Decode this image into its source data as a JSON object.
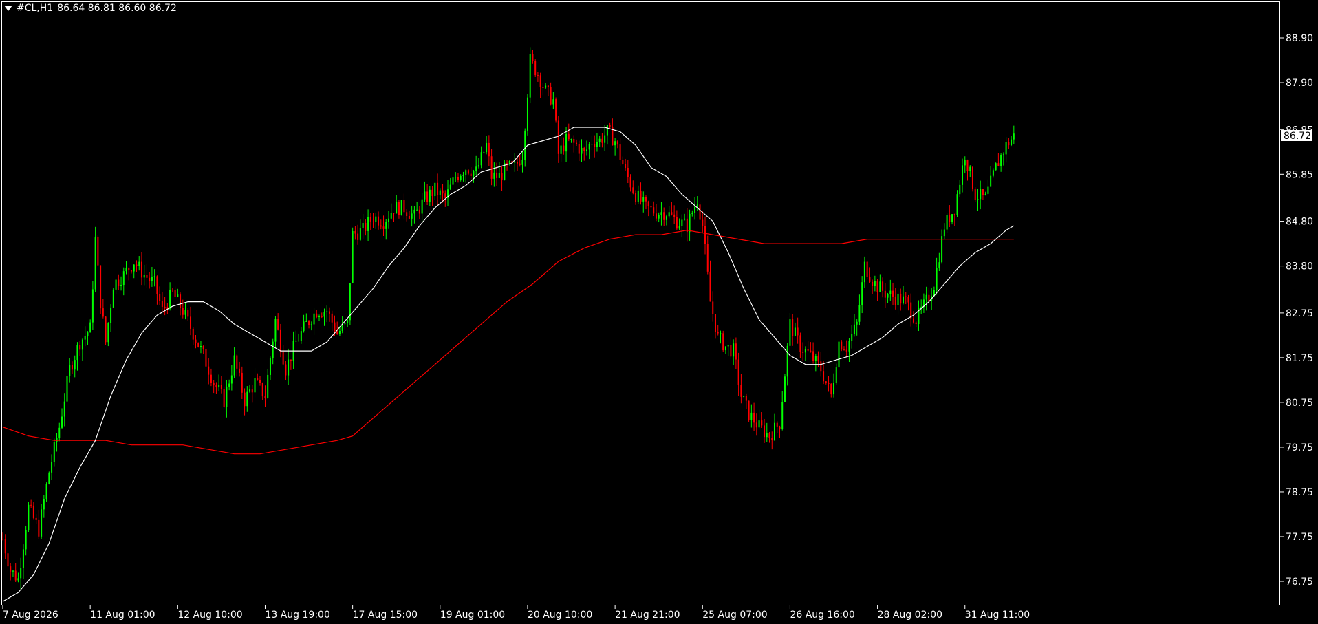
{
  "header": {
    "symbol_tf": "#CL,H1",
    "ohlc": "86.64 86.81 86.60 86.72"
  },
  "colors": {
    "background": "#000000",
    "bull": "#00ff00",
    "bear": "#ff0000",
    "ma_fast": "#ffffff",
    "ma_slow": "#ff0000",
    "axis": "#ffffff"
  },
  "chart_data": {
    "type": "candlestick",
    "symbol": "#CL",
    "timeframe": "H1",
    "last_price_label": "86.72",
    "ylim": [
      76.2,
      89.5
    ],
    "y_ticks": [
      "88.90",
      "87.90",
      "86.85",
      "85.85",
      "84.80",
      "83.80",
      "82.75",
      "81.75",
      "80.75",
      "79.75",
      "78.75",
      "77.75",
      "76.75"
    ],
    "x_labels": [
      "7 Aug 2026",
      "11 Aug 01:00",
      "12 Aug 10:00",
      "13 Aug 19:00",
      "17 Aug 15:00",
      "19 Aug 01:00",
      "20 Aug 10:00",
      "21 Aug 21:00",
      "25 Aug 07:00",
      "26 Aug 16:00",
      "28 Aug 02:00",
      "31 Aug 11:00"
    ],
    "x_label_index": [
      0,
      34,
      68,
      102,
      136,
      170,
      204,
      238,
      272,
      306,
      340,
      374
    ],
    "close_path": [
      [
        0,
        77.7
      ],
      [
        3,
        77.0
      ],
      [
        6,
        76.8
      ],
      [
        10,
        78.4
      ],
      [
        14,
        77.9
      ],
      [
        18,
        79.2
      ],
      [
        22,
        80.2
      ],
      [
        26,
        81.5
      ],
      [
        30,
        82.1
      ],
      [
        34,
        82.4
      ],
      [
        36,
        84.4
      ],
      [
        38,
        83.0
      ],
      [
        40,
        82.1
      ],
      [
        43,
        83.4
      ],
      [
        47,
        83.6
      ],
      [
        51,
        83.9
      ],
      [
        55,
        83.6
      ],
      [
        59,
        83.4
      ],
      [
        62,
        82.8
      ],
      [
        66,
        83.2
      ],
      [
        70,
        82.8
      ],
      [
        74,
        82.3
      ],
      [
        78,
        81.8
      ],
      [
        82,
        81.2
      ],
      [
        86,
        80.8
      ],
      [
        90,
        81.7
      ],
      [
        94,
        80.8
      ],
      [
        98,
        81.2
      ],
      [
        102,
        80.9
      ],
      [
        106,
        82.6
      ],
      [
        110,
        81.5
      ],
      [
        114,
        82.1
      ],
      [
        118,
        82.5
      ],
      [
        122,
        82.8
      ],
      [
        126,
        82.8
      ],
      [
        130,
        82.3
      ],
      [
        134,
        82.5
      ],
      [
        136,
        84.5
      ],
      [
        140,
        84.6
      ],
      [
        144,
        84.9
      ],
      [
        148,
        84.8
      ],
      [
        152,
        85.1
      ],
      [
        156,
        85.1
      ],
      [
        160,
        84.9
      ],
      [
        164,
        85.3
      ],
      [
        168,
        85.5
      ],
      [
        172,
        85.3
      ],
      [
        176,
        85.8
      ],
      [
        180,
        86.0
      ],
      [
        184,
        85.9
      ],
      [
        188,
        86.5
      ],
      [
        190,
        85.8
      ],
      [
        193,
        85.8
      ],
      [
        196,
        86.0
      ],
      [
        199,
        86.0
      ],
      [
        202,
        86.3
      ],
      [
        205,
        88.4
      ],
      [
        208,
        88.1
      ],
      [
        211,
        87.7
      ],
      [
        214,
        87.5
      ],
      [
        216,
        86.3
      ],
      [
        219,
        86.6
      ],
      [
        223,
        86.5
      ],
      [
        226,
        86.3
      ],
      [
        229,
        86.6
      ],
      [
        232,
        86.6
      ],
      [
        235,
        86.8
      ],
      [
        238,
        86.6
      ],
      [
        242,
        85.9
      ],
      [
        246,
        85.4
      ],
      [
        250,
        85.1
      ],
      [
        254,
        85.0
      ],
      [
        258,
        85.0
      ],
      [
        262,
        84.8
      ],
      [
        266,
        84.7
      ],
      [
        270,
        85.3
      ],
      [
        272,
        84.7
      ],
      [
        275,
        83.0
      ],
      [
        278,
        82.2
      ],
      [
        281,
        82.0
      ],
      [
        284,
        81.9
      ],
      [
        287,
        80.9
      ],
      [
        290,
        80.5
      ],
      [
        294,
        80.2
      ],
      [
        298,
        80.0
      ],
      [
        302,
        80.3
      ],
      [
        306,
        82.5
      ],
      [
        310,
        82.0
      ],
      [
        314,
        81.8
      ],
      [
        318,
        81.5
      ],
      [
        322,
        80.9
      ],
      [
        325,
        82.1
      ],
      [
        328,
        82.0
      ],
      [
        332,
        82.5
      ],
      [
        335,
        83.8
      ],
      [
        339,
        83.4
      ],
      [
        343,
        83.2
      ],
      [
        347,
        83.1
      ],
      [
        351,
        83.0
      ],
      [
        355,
        82.6
      ],
      [
        359,
        83.0
      ],
      [
        362,
        83.4
      ],
      [
        366,
        84.7
      ],
      [
        370,
        85.1
      ],
      [
        374,
        86.3
      ],
      [
        378,
        85.4
      ],
      [
        382,
        85.3
      ],
      [
        386,
        86.0
      ],
      [
        390,
        86.5
      ],
      [
        393,
        86.7
      ]
    ],
    "series": [
      {
        "type": "moving_average",
        "points": [
          [
            0,
            76.3
          ],
          [
            6,
            76.5
          ],
          [
            12,
            76.9
          ],
          [
            18,
            77.6
          ],
          [
            24,
            78.6
          ],
          [
            30,
            79.3
          ],
          [
            36,
            79.9
          ],
          [
            42,
            80.9
          ],
          [
            48,
            81.7
          ],
          [
            54,
            82.3
          ],
          [
            60,
            82.7
          ],
          [
            66,
            82.9
          ],
          [
            72,
            83.0
          ],
          [
            78,
            83.0
          ],
          [
            84,
            82.8
          ],
          [
            90,
            82.5
          ],
          [
            96,
            82.3
          ],
          [
            102,
            82.1
          ],
          [
            108,
            81.9
          ],
          [
            114,
            81.9
          ],
          [
            120,
            81.9
          ],
          [
            126,
            82.1
          ],
          [
            132,
            82.5
          ],
          [
            138,
            82.9
          ],
          [
            144,
            83.3
          ],
          [
            150,
            83.8
          ],
          [
            156,
            84.2
          ],
          [
            162,
            84.7
          ],
          [
            168,
            85.1
          ],
          [
            174,
            85.4
          ],
          [
            180,
            85.6
          ],
          [
            186,
            85.9
          ],
          [
            192,
            86.0
          ],
          [
            198,
            86.1
          ],
          [
            204,
            86.5
          ],
          [
            210,
            86.6
          ],
          [
            216,
            86.7
          ],
          [
            222,
            86.9
          ],
          [
            228,
            86.9
          ],
          [
            234,
            86.9
          ],
          [
            240,
            86.8
          ],
          [
            246,
            86.5
          ],
          [
            252,
            86.0
          ],
          [
            258,
            85.8
          ],
          [
            264,
            85.4
          ],
          [
            270,
            85.1
          ],
          [
            276,
            84.8
          ],
          [
            282,
            84.1
          ],
          [
            288,
            83.3
          ],
          [
            294,
            82.6
          ],
          [
            300,
            82.2
          ],
          [
            306,
            81.8
          ],
          [
            312,
            81.6
          ],
          [
            318,
            81.6
          ],
          [
            324,
            81.7
          ],
          [
            330,
            81.8
          ],
          [
            336,
            82.0
          ],
          [
            342,
            82.2
          ],
          [
            348,
            82.5
          ],
          [
            354,
            82.7
          ],
          [
            360,
            83.0
          ],
          [
            366,
            83.4
          ],
          [
            372,
            83.8
          ],
          [
            378,
            84.1
          ],
          [
            384,
            84.3
          ],
          [
            390,
            84.6
          ],
          [
            393,
            84.7
          ]
        ]
      },
      {
        "type": "moving_average",
        "points": [
          [
            0,
            80.2
          ],
          [
            10,
            80.0
          ],
          [
            20,
            79.9
          ],
          [
            30,
            79.9
          ],
          [
            40,
            79.9
          ],
          [
            50,
            79.8
          ],
          [
            60,
            79.8
          ],
          [
            70,
            79.8
          ],
          [
            80,
            79.7
          ],
          [
            90,
            79.6
          ],
          [
            100,
            79.6
          ],
          [
            110,
            79.7
          ],
          [
            120,
            79.8
          ],
          [
            130,
            79.9
          ],
          [
            136,
            80.0
          ],
          [
            146,
            80.5
          ],
          [
            156,
            81.0
          ],
          [
            166,
            81.5
          ],
          [
            176,
            82.0
          ],
          [
            186,
            82.5
          ],
          [
            196,
            83.0
          ],
          [
            206,
            83.4
          ],
          [
            216,
            83.9
          ],
          [
            226,
            84.2
          ],
          [
            236,
            84.4
          ],
          [
            246,
            84.5
          ],
          [
            256,
            84.5
          ],
          [
            266,
            84.6
          ],
          [
            276,
            84.5
          ],
          [
            286,
            84.4
          ],
          [
            296,
            84.3
          ],
          [
            306,
            84.3
          ],
          [
            316,
            84.3
          ],
          [
            326,
            84.3
          ],
          [
            336,
            84.4
          ],
          [
            346,
            84.4
          ],
          [
            356,
            84.4
          ],
          [
            366,
            84.4
          ],
          [
            376,
            84.4
          ],
          [
            386,
            84.4
          ],
          [
            393,
            84.4
          ]
        ]
      }
    ]
  }
}
